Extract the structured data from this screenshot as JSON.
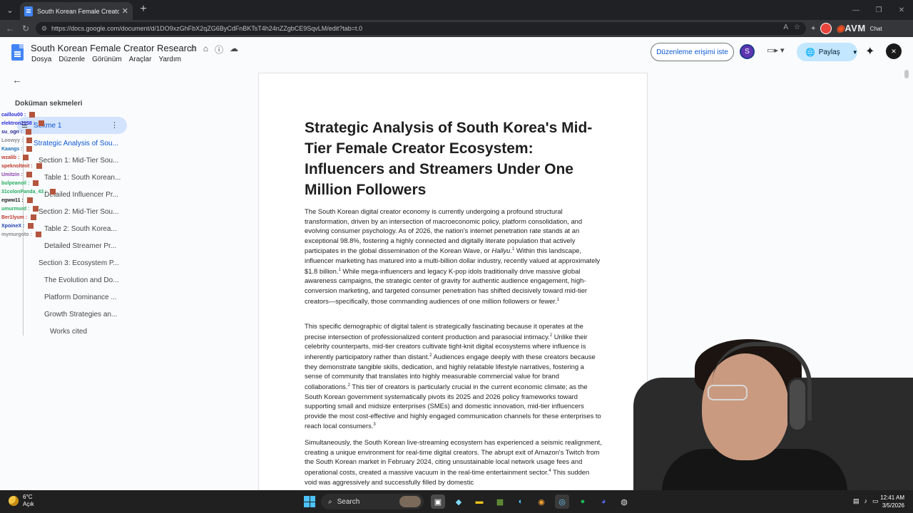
{
  "browser": {
    "tab_title": "South Korean Female Creator Rese",
    "url": "https://docs.google.com/document/d/1DO9xzGhFbX2qZG6ByCdFnBKTsT4h24nZZgbCE9SqvLM/edit?tab=t.0",
    "extension_logo": "AVM",
    "extension_chat": "Chat"
  },
  "docs": {
    "title": "South Korean Female Creator Research",
    "menu": [
      "Dosya",
      "Düzenle",
      "Görünüm",
      "Araçlar",
      "Yardım"
    ],
    "edit_access_button": "Düzenleme erişimi iste",
    "avatar_letter": "S",
    "share_button": "Paylaş"
  },
  "sidebar": {
    "heading": "Doküman sekmeleri",
    "tab_label": "Sekme 1",
    "outline": [
      "Strategic Analysis of Sou...",
      "Section 1: Mid-Tier Sou...",
      "Table 1: South Korean...",
      "Detailed Influencer Pr...",
      "Section 2: Mid-Tier Sou...",
      "Table 2: South Korea...",
      "Detailed Streamer Pr...",
      "Section 3: Ecosystem P...",
      "The Evolution and Do...",
      "Platform Dominance ...",
      "Growth Strategies an...",
      "Works cited"
    ]
  },
  "chat_overlay": [
    {
      "name": "caillou00",
      "msg": "",
      "color": "#2b2bd6"
    },
    {
      "name": "elektron2158",
      "msg": "",
      "color": "#2b2bd6"
    },
    {
      "name": "su_ogn",
      "msg": "",
      "color": "#1f1f8f"
    },
    {
      "name": "Loowyy",
      "msg": "",
      "color": "#8a8a8a"
    },
    {
      "name": "Kaangs",
      "msg": "",
      "color": "#1f6fb5"
    },
    {
      "name": "wzalib",
      "msg": "",
      "color": "#c0392b"
    },
    {
      "name": "speknoltmit",
      "msg": "",
      "color": "#c0392b"
    },
    {
      "name": "Umitzin",
      "msg": "",
      "color": "#8e44ad"
    },
    {
      "name": "bulpeanoil",
      "msg": "",
      "color": "#27ae60"
    },
    {
      "name": "31colonPanda_43",
      "msg": "",
      "color": "#27ae60"
    },
    {
      "name": "egww11",
      "msg": "",
      "color": "#1f1f1f"
    },
    {
      "name": "umurmurd",
      "msg": "",
      "color": "#27ae60"
    },
    {
      "name": "Ber1lyum",
      "msg": "",
      "color": "#c0392b"
    },
    {
      "name": "XpoineX",
      "msg": "",
      "color": "#1f3fae"
    },
    {
      "name": "mymurgoto",
      "msg": "",
      "color": "#8a8a8a"
    }
  ],
  "document": {
    "heading": "Strategic Analysis of South Korea's Mid-Tier Female Creator Ecosystem: Influencers and Streamers Under One Million Followers",
    "p1": {
      "a": "The South Korean digital creator economy is currently undergoing a profound structural transformation, driven by an intersection of macroeconomic policy, platform consolidation, and evolving consumer psychology. As of 2026, the nation's internet penetration rate stands at an exceptional 98.8%, fostering a highly connected and digitally literate population that actively participates in the global dissemination of the Korean Wave, or ",
      "italic": "Hallyu",
      "sup1": "1",
      "b": " Within this landscape, influencer marketing has matured into a multi-billion dollar industry, recently valued at approximately $1.8 billion.",
      "sup2": "1",
      "c": " While mega-influencers and legacy K-pop idols traditionally drive massive global awareness campaigns, the strategic center of gravity for authentic audience engagement, high-conversion marketing, and targeted consumer penetration has shifted decisively toward mid-tier creators—specifically, those commanding audiences of one million followers or fewer.",
      "sup3": "1"
    },
    "p2": {
      "a": "This specific demographic of digital talent is strategically fascinating because it operates at the precise intersection of professionalized content production and parasocial intimacy.",
      "sup1": "2",
      "b": " Unlike their celebrity counterparts, mid-tier creators cultivate tight-knit digital ecosystems where influence is inherently participatory rather than distant.",
      "sup2": "2",
      "c": " Audiences engage deeply with these creators because they demonstrate tangible skills, dedication, and highly relatable lifestyle narratives, fostering a sense of community that translates into highly measurable commercial value for brand collaborations.",
      "sup3": "2",
      "d": " This tier of creators is particularly crucial in the current economic climate; as the South Korean government systematically pivots its 2025 and 2026 policy frameworks toward supporting small and midsize enterprises (SMEs) and domestic innovation, mid-tier influencers provide the most cost-effective and highly engaged communication channels for these enterprises to reach local consumers.",
      "sup4": "3"
    },
    "p3": {
      "a": "Simultaneously, the South Korean live-streaming ecosystem has experienced a seismic realignment, creating a unique environment for real-time digital creators. The abrupt exit of Amazon's Twitch from the South Korean market in February 2024, citing unsustainable local network usage fees and operational costs, created a massive vacuum in the real-time entertainment sector.",
      "sup1": "4",
      "b": " This sudden void was aggressively and successfully filled by domestic"
    }
  },
  "taskbar": {
    "temperature": "6°C",
    "condition": "Açık",
    "search_label": "Search",
    "time": "12:41 AM",
    "date": "3/5/2026"
  },
  "colors": {
    "accent": "#0b57d0",
    "share_bg": "#c2e7ff",
    "active_tab_bg": "#d3e3fd",
    "docs_bg": "#f9fbfd"
  }
}
